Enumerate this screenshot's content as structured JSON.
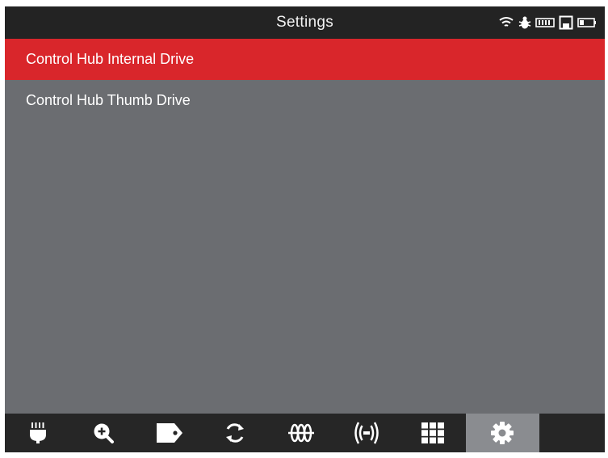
{
  "header": {
    "title": "Settings",
    "status_icons": [
      "wifi-icon",
      "bug-icon",
      "battery-meter-icon",
      "save-icon",
      "battery-icon"
    ]
  },
  "list": {
    "items": [
      {
        "label": "Control Hub Internal Drive",
        "selected": true
      },
      {
        "label": "Control Hub Thumb Drive",
        "selected": false
      }
    ]
  },
  "toolbar": {
    "tools": [
      {
        "icon": "plug-icon"
      },
      {
        "icon": "zoom-in-icon"
      },
      {
        "icon": "tag-icon"
      },
      {
        "icon": "refresh-icon"
      },
      {
        "icon": "coil-icon"
      },
      {
        "icon": "signal-icon"
      },
      {
        "icon": "grid-icon"
      },
      {
        "icon": "gear-icon",
        "active": true
      }
    ]
  },
  "colors": {
    "titlebar": "#232323",
    "selection": "#d9262b",
    "background": "#6b6d71",
    "toolbar": "#262626",
    "active_tool": "#8a8c90"
  }
}
